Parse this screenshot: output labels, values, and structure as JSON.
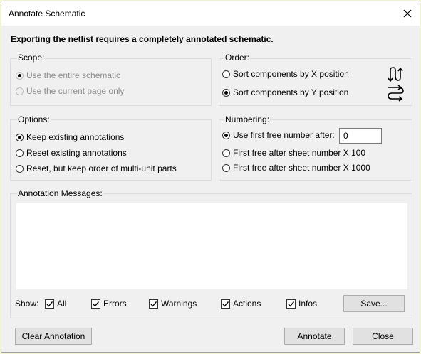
{
  "window": {
    "title": "Annotate Schematic"
  },
  "warning": "Exporting the netlist requires a completely annotated schematic.",
  "scope": {
    "label": "Scope:",
    "options": [
      {
        "label": "Use the entire schematic",
        "checked": true,
        "enabled": false
      },
      {
        "label": "Use the current page only",
        "checked": false,
        "enabled": false
      }
    ]
  },
  "order": {
    "label": "Order:",
    "options": [
      {
        "label": "Sort components by X position",
        "checked": false,
        "icon": "sort-x-icon"
      },
      {
        "label": "Sort components by Y position",
        "checked": true,
        "icon": "sort-y-icon"
      }
    ]
  },
  "options": {
    "label": "Options:",
    "options": [
      {
        "label": "Keep existing annotations",
        "checked": true
      },
      {
        "label": "Reset existing annotations",
        "checked": false
      },
      {
        "label": "Reset, but keep order of multi-unit parts",
        "checked": false
      }
    ]
  },
  "numbering": {
    "label": "Numbering:",
    "options": [
      {
        "label": "Use first free number after:",
        "checked": true
      },
      {
        "label": "First free after sheet number X 100",
        "checked": false
      },
      {
        "label": "First free after sheet number X 1000",
        "checked": false
      }
    ],
    "first_free_value": "0"
  },
  "messages": {
    "label": "Annotation Messages:",
    "show_label": "Show:",
    "filters": [
      {
        "label": "All",
        "checked": true
      },
      {
        "label": "Errors",
        "checked": true
      },
      {
        "label": "Warnings",
        "checked": true
      },
      {
        "label": "Actions",
        "checked": true
      },
      {
        "label": "Infos",
        "checked": true
      }
    ],
    "save_label": "Save..."
  },
  "buttons": {
    "clear": "Clear Annotation",
    "annotate": "Annotate",
    "close": "Close"
  },
  "colors": {
    "dialog_bg": "#f0f0f0",
    "button_bg": "#e1e1e1",
    "group_border": "#dcdcdc"
  }
}
